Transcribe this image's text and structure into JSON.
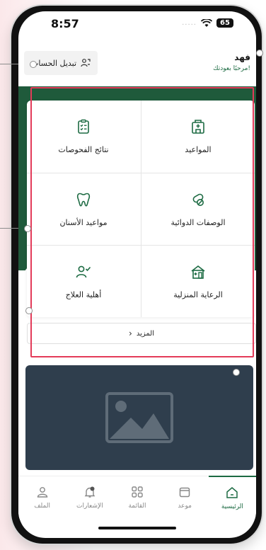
{
  "status": {
    "time": "8:57",
    "battery": "65"
  },
  "header": {
    "switch_account": "تبديل الحساب",
    "user_name": "فهد",
    "welcome": "مرحبًا بعودتك!"
  },
  "services": [
    {
      "label": "المواعيد",
      "icon": "hospital-icon"
    },
    {
      "label": "نتائج الفحوصات",
      "icon": "clipboard-checklist-icon"
    },
    {
      "label": "الوصفات الدوائية",
      "icon": "pill-icon"
    },
    {
      "label": "مواعيد الأسنان",
      "icon": "tooth-icon"
    },
    {
      "label": "الرعاية المنزلية",
      "icon": "house-care-icon"
    },
    {
      "label": "أهلية العلاج",
      "icon": "user-check-icon"
    }
  ],
  "more_label": "المزيد",
  "tabs": [
    {
      "label": "الرئيسية",
      "icon": "home-icon",
      "active": true
    },
    {
      "label": "موعد",
      "icon": "calendar-icon",
      "active": false
    },
    {
      "label": "القائمة",
      "icon": "grid-menu-icon",
      "active": false
    },
    {
      "label": "الإشعارات",
      "icon": "bell-icon",
      "active": false
    },
    {
      "label": "الملف",
      "icon": "profile-icon",
      "active": false
    }
  ],
  "colors": {
    "accent": "#1d6b43",
    "highlight": "#e33b59",
    "banner": "#2f3e4d"
  }
}
